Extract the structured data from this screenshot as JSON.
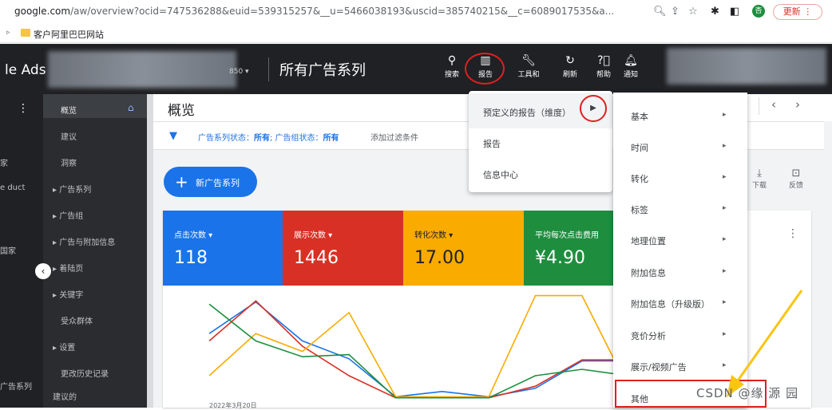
{
  "browser": {
    "url_domain": "google.com",
    "url_path": "/aw/overview?ocid=747536288&euid=539315257&__u=5466038193&uscid=385740215&__c=6089017535&a...",
    "update_label": "更新",
    "profile_letter": "杏",
    "bookmark_label": "客户阿里巴巴网站"
  },
  "header": {
    "logo": "le Ads",
    "account_suffix": "850 ▾",
    "campaign_title": "所有广告系列",
    "tools": [
      {
        "icon": "search-icon",
        "label": "搜索"
      },
      {
        "icon": "report-icon",
        "label": "报告"
      },
      {
        "icon": "wrench-icon",
        "label": "工具和"
      },
      {
        "icon": "refresh-icon",
        "label": "刷新"
      },
      {
        "icon": "help-icon",
        "label": "帮助"
      },
      {
        "icon": "bell-icon",
        "label": "通知"
      }
    ]
  },
  "leftbar": {
    "items": [
      "家",
      "e duct",
      "国家",
      "广告系列"
    ]
  },
  "subnav": {
    "items": [
      "概览",
      "建议",
      "洞察",
      "▸ 广告系列",
      "▸ 广告组",
      "▸ 广告与附加信息",
      "▸ 着陆页",
      "▸ 关键字",
      "受众群体",
      "▸ 设置",
      "更改历史记录",
      "建议的"
    ]
  },
  "main": {
    "page_title": "概览",
    "filter_text_prefix": "广告系列状态：",
    "filter_all1": "所有",
    "filter_mid": "; 广告组状态：",
    "filter_all2": "所有",
    "add_filter": "添加过滤条件",
    "new_campaign": "新广告系列",
    "download": "下载",
    "feedback": "反馈",
    "x_label": "2022年3月20日"
  },
  "metrics": [
    {
      "name": "点击次数 ▾",
      "value": "118",
      "color": "#1a73e8"
    },
    {
      "name": "展示次数 ▾",
      "value": "1446",
      "color": "#d93025"
    },
    {
      "name": "转化次数 ▾",
      "value": "17.00",
      "color": "#f9ab00"
    },
    {
      "name": "平均每次点击费用",
      "value": "¥4.90",
      "color": "#1e8e3e"
    }
  ],
  "chart_data": {
    "type": "line",
    "x": [
      1,
      2,
      3,
      4,
      5,
      6,
      7,
      8,
      9,
      10,
      11,
      12,
      13,
      14,
      15,
      16,
      17,
      18,
      19,
      20
    ],
    "series": [
      {
        "color": "#1a73e8",
        "values": [
          0.62,
          0.92,
          0.55,
          0.38,
          0.02,
          0.07,
          0.02,
          0.1,
          0.36,
          0.36,
          0.39,
          0.55
        ]
      },
      {
        "color": "#d93025",
        "values": [
          0.55,
          0.93,
          0.5,
          0.22,
          0.01,
          0.01,
          0.01,
          0.12,
          0.37,
          0.37,
          0.37,
          0.48
        ]
      },
      {
        "color": "#f9ab00",
        "values": [
          0.22,
          0.62,
          0.45,
          0.82,
          0.02,
          0.02,
          0.02,
          0.98,
          0.98,
          0.1,
          0.75,
          0.9
        ]
      },
      {
        "color": "#1e8e3e",
        "values": [
          0.9,
          0.55,
          0.4,
          0.42,
          0.01,
          0.01,
          0.01,
          0.22,
          0.28,
          0.22,
          0.35,
          0.5
        ]
      }
    ],
    "xlabel": "2022年3月20日"
  },
  "menu1": {
    "items": [
      {
        "label": "预定义的报告（维度）",
        "has_arrow": true
      },
      {
        "label": "报告",
        "has_arrow": false
      },
      {
        "label": "信息中心",
        "has_arrow": false
      }
    ]
  },
  "menu2": {
    "items": [
      "基本",
      "时间",
      "转化",
      "标签",
      "地理位置",
      "附加信息",
      "附加信息（升级版）",
      "竞价分析",
      "展示/视频广告",
      "其他"
    ]
  },
  "watermark": "CSDN @缘 源 园"
}
